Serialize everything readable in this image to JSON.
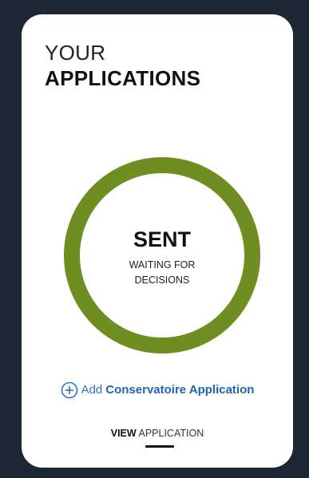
{
  "card": {
    "heading_light": "YOUR",
    "heading_bold": "APPLICATIONS"
  },
  "status": {
    "title": "SENT",
    "subtitle": "WAITING FOR DECISIONS",
    "ring_color": "#6f8e22"
  },
  "actions": {
    "add_prefix": "Add",
    "add_strong": "Conservatoire Application",
    "add_icon": "plus-circle-icon",
    "view_strong": "VIEW",
    "view_normal": "APPLICATION"
  },
  "colors": {
    "background": "#1e2635",
    "card": "#ffffff",
    "link": "#2a73c6"
  }
}
